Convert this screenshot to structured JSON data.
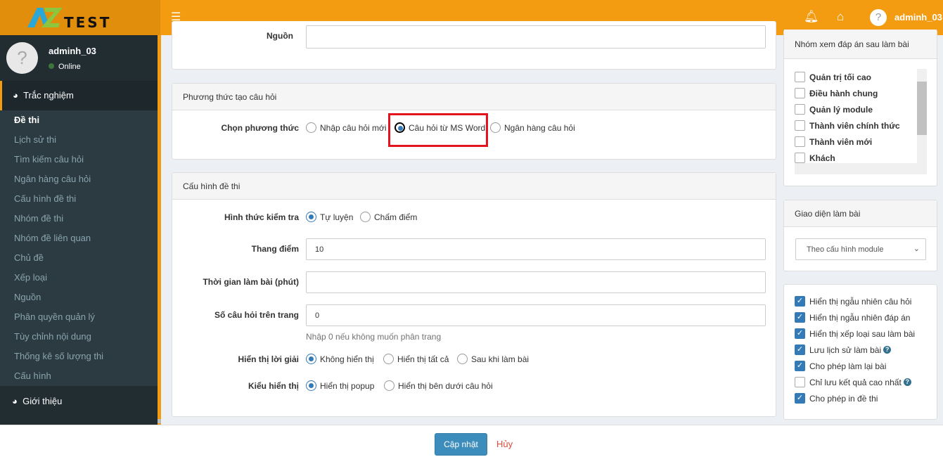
{
  "header": {
    "logo": "AZTEST",
    "menu_icon": "bars-icon",
    "bell_icon": "bell-icon",
    "home_icon": "home-icon",
    "username": "adminh_03"
  },
  "sidebar": {
    "user": {
      "name": "adminh_03",
      "status": "Online"
    },
    "sections": [
      {
        "label": "Trắc nghiệm",
        "icon": "globe-icon"
      },
      {
        "label": "Giới thiệu",
        "icon": "globe-icon"
      }
    ],
    "items": [
      {
        "label": "Đề thi",
        "active": true
      },
      {
        "label": "Lịch sử thi"
      },
      {
        "label": "Tìm kiếm câu hỏi"
      },
      {
        "label": "Ngân hàng câu hỏi"
      },
      {
        "label": "Cấu hình đề thi"
      },
      {
        "label": "Nhóm đề thi"
      },
      {
        "label": "Nhóm đề liên quan"
      },
      {
        "label": "Chủ đề"
      },
      {
        "label": "Xếp loại"
      },
      {
        "label": "Nguồn"
      },
      {
        "label": "Phân quyền quản lý"
      },
      {
        "label": "Tùy chỉnh nội dung"
      },
      {
        "label": "Thống kê số lượng thi"
      },
      {
        "label": "Cấu hình"
      }
    ]
  },
  "source_panel": {
    "label": "Nguồn",
    "value": ""
  },
  "method_panel": {
    "title": "Phương thức tạo câu hỏi",
    "label": "Chọn phương thức",
    "options": [
      "Nhập câu hỏi mới",
      "Câu hỏi từ MS Word",
      "Ngân hàng câu hỏi"
    ],
    "selected": "Câu hỏi từ MS Word",
    "highlight_color": "#e3141e"
  },
  "config_panel": {
    "title": "Cấu hình đề thi",
    "test_type": {
      "label": "Hình thức kiểm tra",
      "options": [
        "Tự luyện",
        "Chấm điểm"
      ],
      "selected": "Tự luyện"
    },
    "scale": {
      "label": "Thang điểm",
      "value": "10"
    },
    "duration": {
      "label": "Thời gian làm bài (phút)",
      "value": ""
    },
    "per_page": {
      "label": "Số câu hỏi trên trang",
      "value": "0",
      "help": "Nhập 0 nếu không muốn phân trang"
    },
    "solution": {
      "label": "Hiển thị lời giải",
      "options": [
        "Không hiển thị",
        "Hiển thị tất cả",
        "Sau khi làm bài"
      ],
      "selected": "Không hiển thị"
    },
    "display": {
      "label": "Kiểu hiển thị",
      "options": [
        "Hiển thị popup",
        "Hiển thị bên dưới câu hỏi"
      ],
      "selected": "Hiển thị popup"
    }
  },
  "right": {
    "groups": {
      "title": "Nhóm xem đáp án sau làm bài",
      "items": [
        "Quản trị tối cao",
        "Điều hành chung",
        "Quản lý module",
        "Thành viên chính thức",
        "Thành viên mới",
        "Khách"
      ]
    },
    "ui": {
      "title": "Giao diện làm bài",
      "selected": "Theo cấu hình module"
    },
    "options": [
      {
        "label": "Hiển thị ngẫu nhiên câu hỏi",
        "checked": true
      },
      {
        "label": "Hiển thị ngẫu nhiên đáp án",
        "checked": true
      },
      {
        "label": "Hiển thị xếp loại sau làm bài",
        "checked": true
      },
      {
        "label": "Lưu lịch sử làm bài",
        "checked": true,
        "help": true
      },
      {
        "label": "Cho phép làm lại bài",
        "checked": true
      },
      {
        "label": "Chỉ lưu kết quả cao nhất",
        "checked": false,
        "help": true
      },
      {
        "label": "Cho phép in đề thi",
        "checked": true
      }
    ]
  },
  "footer": {
    "save": "Cập nhật",
    "cancel": "Hủy"
  },
  "colors": {
    "header": "#f39c12",
    "sidebar": "#222d32",
    "primary": "#3c8dbc"
  }
}
